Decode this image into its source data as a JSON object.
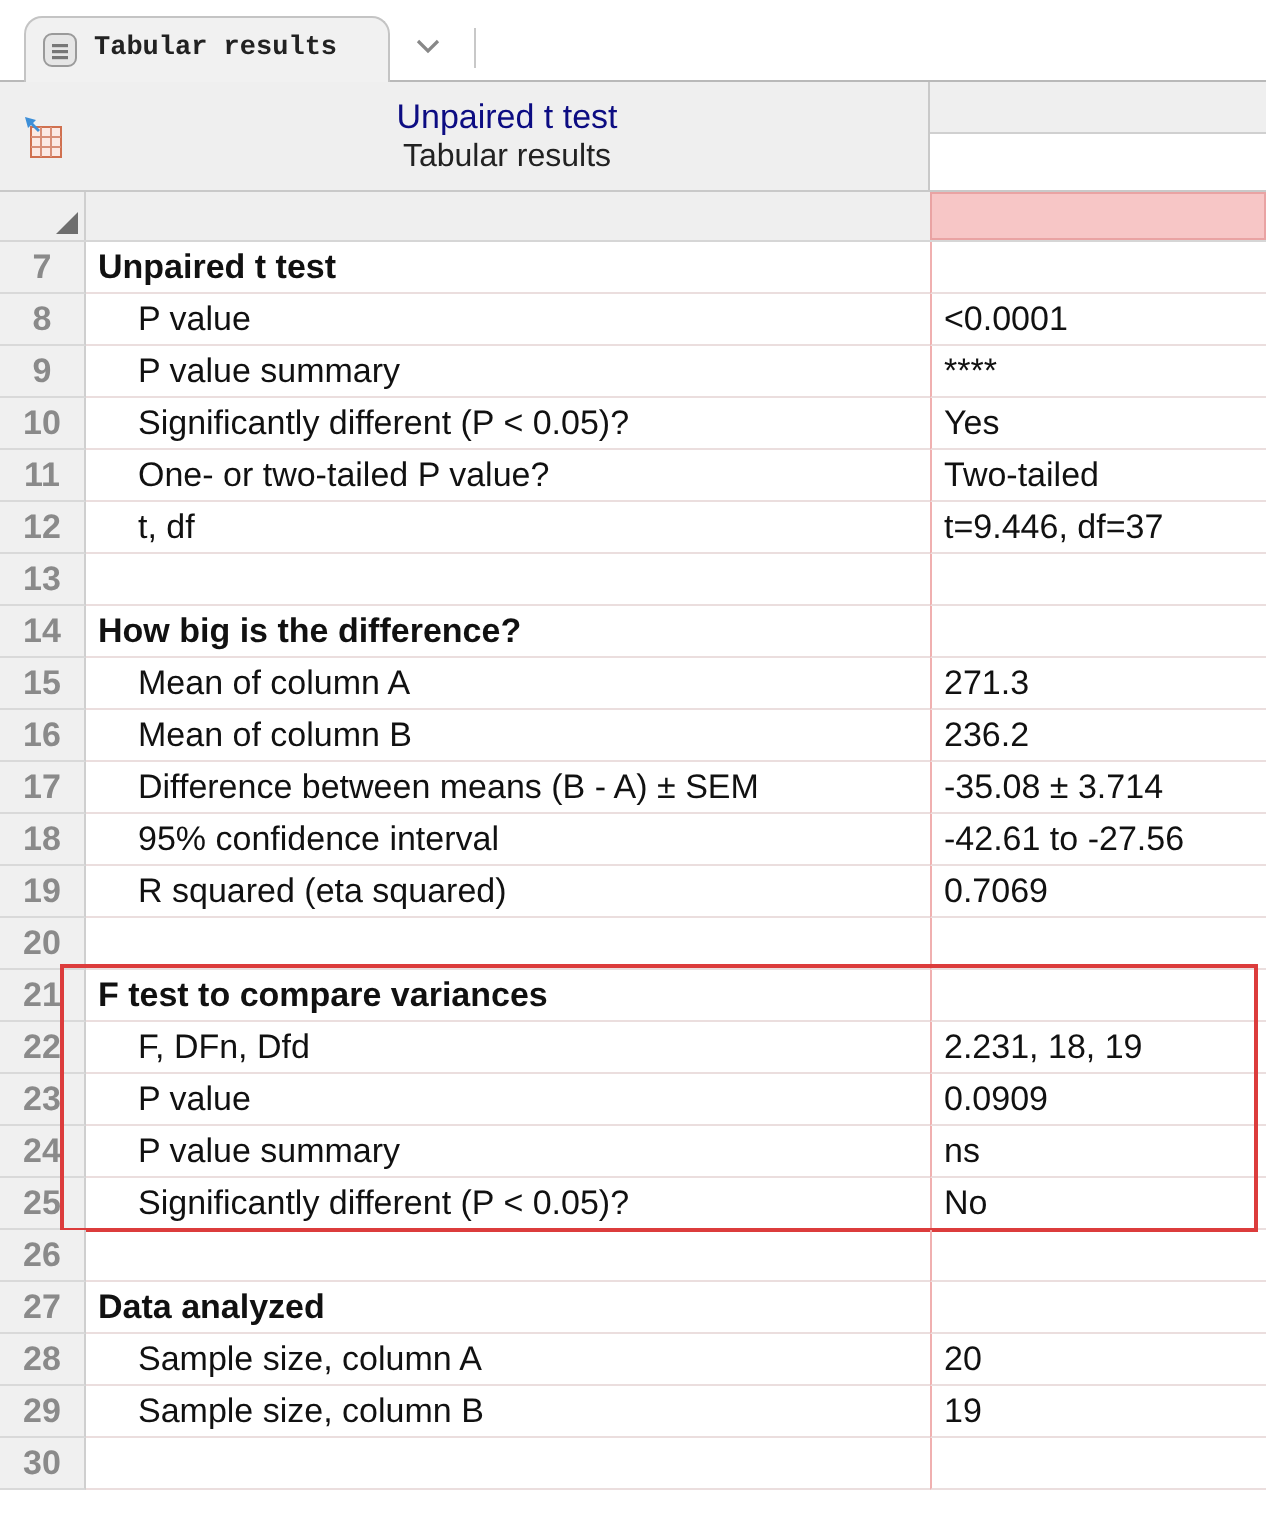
{
  "tab": {
    "label": "Tabular results",
    "selected": true
  },
  "header": {
    "title": "Unpaired t test",
    "subtitle": "Tabular results"
  },
  "value_column": {
    "selected": true
  },
  "sections": [
    {
      "highlighted": false,
      "rows": [
        {
          "number": "7",
          "kind": "heading",
          "label": "Unpaired t test"
        },
        {
          "number": "8",
          "kind": "item",
          "label": "P value",
          "value": "<0.0001"
        },
        {
          "number": "9",
          "kind": "item",
          "label": "P value summary",
          "value": "****"
        },
        {
          "number": "10",
          "kind": "item",
          "label": "Significantly different (P < 0.05)?",
          "value": "Yes"
        },
        {
          "number": "11",
          "kind": "item",
          "label": "One- or two-tailed P value?",
          "value": "Two-tailed"
        },
        {
          "number": "12",
          "kind": "item",
          "label": "t, df",
          "value": "t=9.446, df=37"
        },
        {
          "number": "13",
          "kind": "blank"
        }
      ]
    },
    {
      "highlighted": false,
      "rows": [
        {
          "number": "14",
          "kind": "heading",
          "label": "How big is the difference?"
        },
        {
          "number": "15",
          "kind": "item",
          "label": "Mean of column A",
          "value": "271.3"
        },
        {
          "number": "16",
          "kind": "item",
          "label": "Mean of column B",
          "value": "236.2"
        },
        {
          "number": "17",
          "kind": "item",
          "label": "Difference between means (B - A) ± SEM",
          "value": "-35.08 ± 3.714"
        },
        {
          "number": "18",
          "kind": "item",
          "label": "95% confidence interval",
          "value": "-42.61 to -27.56"
        },
        {
          "number": "19",
          "kind": "item",
          "label": "R squared (eta squared)",
          "value": "0.7069"
        },
        {
          "number": "20",
          "kind": "blank"
        }
      ]
    },
    {
      "highlighted": true,
      "rows": [
        {
          "number": "21",
          "kind": "heading",
          "label": "F test to compare variances"
        },
        {
          "number": "22",
          "kind": "item",
          "label": "F, DFn, Dfd",
          "value": "2.231, 18, 19"
        },
        {
          "number": "23",
          "kind": "item",
          "label": "P value",
          "value": "0.0909"
        },
        {
          "number": "24",
          "kind": "item",
          "label": "P value summary",
          "value": "ns"
        },
        {
          "number": "25",
          "kind": "item",
          "label": "Significantly different (P < 0.05)?",
          "value": "No"
        }
      ]
    },
    {
      "highlighted": false,
      "rows": [
        {
          "number": "26",
          "kind": "blank"
        },
        {
          "number": "27",
          "kind": "heading",
          "label": "Data analyzed"
        },
        {
          "number": "28",
          "kind": "item",
          "label": "Sample size, column A",
          "value": "20"
        },
        {
          "number": "29",
          "kind": "item",
          "label": "Sample size, column B",
          "value": "19"
        },
        {
          "number": "30",
          "kind": "blank"
        }
      ]
    }
  ]
}
